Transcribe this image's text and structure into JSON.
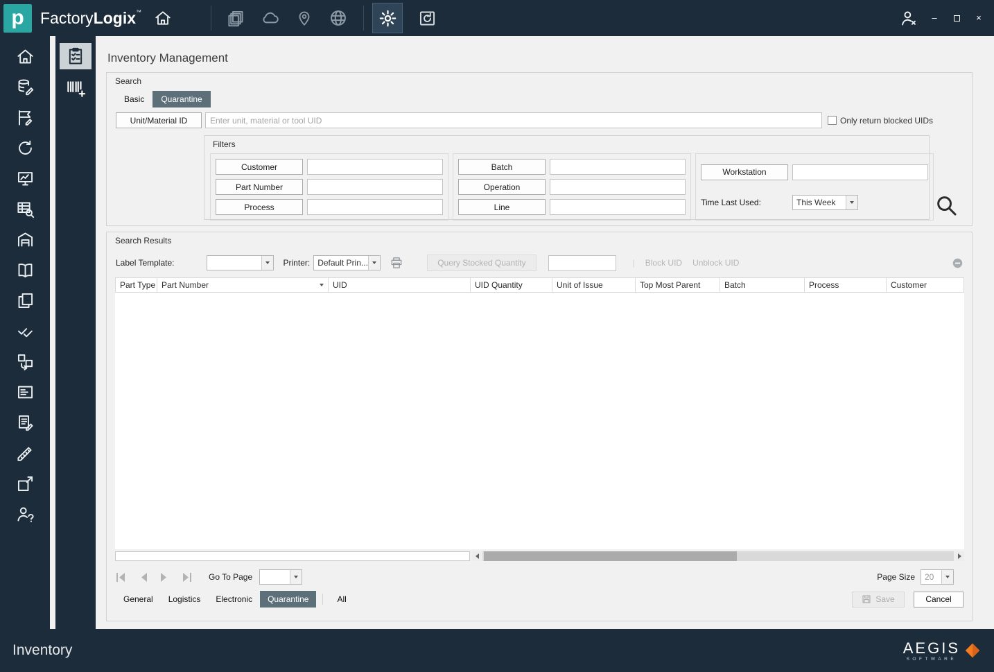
{
  "colors": {
    "dark": "#1d2c3a",
    "teal": "#2aa7a2",
    "active_tab": "#5d6f78",
    "brand_orange": "#f47b20"
  },
  "titlebar": {
    "logo_letter": "p",
    "app_name_regular": "Factory",
    "app_name_bold": "Logix",
    "trademark": "™",
    "window_minimize": "–",
    "window_close": "×"
  },
  "page": {
    "title": "Inventory Management"
  },
  "search": {
    "group_label": "Search",
    "tabs": [
      {
        "label": "Basic"
      },
      {
        "label": "Quarantine",
        "active": true
      }
    ],
    "unit_material_button": "Unit/Material ID",
    "unit_input_placeholder": "Enter unit, material or tool UID",
    "unit_input_value": "",
    "only_blocked_label": "Only return blocked UIDs",
    "only_blocked_checked": false,
    "filters": {
      "group_label": "Filters",
      "column1": [
        {
          "label": "Customer",
          "value": ""
        },
        {
          "label": "Part Number",
          "value": ""
        },
        {
          "label": "Process",
          "value": ""
        }
      ],
      "column2": [
        {
          "label": "Batch",
          "value": ""
        },
        {
          "label": "Operation",
          "value": ""
        },
        {
          "label": "Line",
          "value": ""
        }
      ],
      "workstation_button": "Workstation",
      "workstation_value": "",
      "time_last_used_label": "Time Last Used:",
      "time_last_used_value": "This Week"
    }
  },
  "results": {
    "group_label": "Search Results",
    "label_template_label": "Label Template:",
    "label_template_value": "",
    "printer_label": "Printer:",
    "printer_value": "Default Prin...",
    "query_stocked_quantity": "Query Stocked Quantity",
    "quantity_value": "",
    "separator": "|",
    "block_uid": "Block UID",
    "unblock_uid": "Unblock UID",
    "table": {
      "columns": [
        "Part Type",
        "Part Number",
        "UID",
        "UID Quantity",
        "Unit of Issue",
        "Top Most Parent",
        "Batch",
        "Process",
        "Customer"
      ],
      "rows": []
    },
    "pager": {
      "go_to_page_label": "Go To Page",
      "go_to_page_value": "",
      "page_size_label": "Page Size",
      "page_size_value": "20"
    },
    "bottom_tabs": [
      {
        "label": "General"
      },
      {
        "label": "Logistics"
      },
      {
        "label": "Electronic"
      },
      {
        "label": "Quarantine",
        "active": true
      },
      {
        "label": "All"
      }
    ],
    "save_button": "Save",
    "cancel_button": "Cancel"
  },
  "statusbar": {
    "title": "Inventory",
    "brand_name": "AEGIS",
    "brand_subtitle": "SOFTWARE"
  },
  "icons": {
    "top_nav": [
      "home-icon",
      "documents-icon",
      "cloud-icon",
      "location-pin-icon",
      "globe-icon",
      "gear-icon",
      "history-icon",
      "user-logout-icon"
    ],
    "sidebar_primary": [
      "home-icon",
      "database-edit-icon",
      "report-flag-icon",
      "refresh-icon",
      "monitor-chart-icon",
      "table-search-icon",
      "warehouse-icon",
      "book-icon",
      "documents-icon",
      "double-check-icon",
      "transfer-icon",
      "id-card-icon",
      "document-edit-icon",
      "design-ruler-icon",
      "package-out-icon",
      "person-question-icon"
    ],
    "sidebar_secondary": [
      "checklist-icon",
      "barcode-add-icon"
    ],
    "misc": [
      "search-icon",
      "printer-icon",
      "remove-circle-icon",
      "save-icon",
      "sort-desc-icon",
      "scroll-left-icon",
      "scroll-right-icon",
      "pager-first-icon",
      "pager-prev-icon",
      "pager-next-icon",
      "pager-last-icon"
    ]
  }
}
